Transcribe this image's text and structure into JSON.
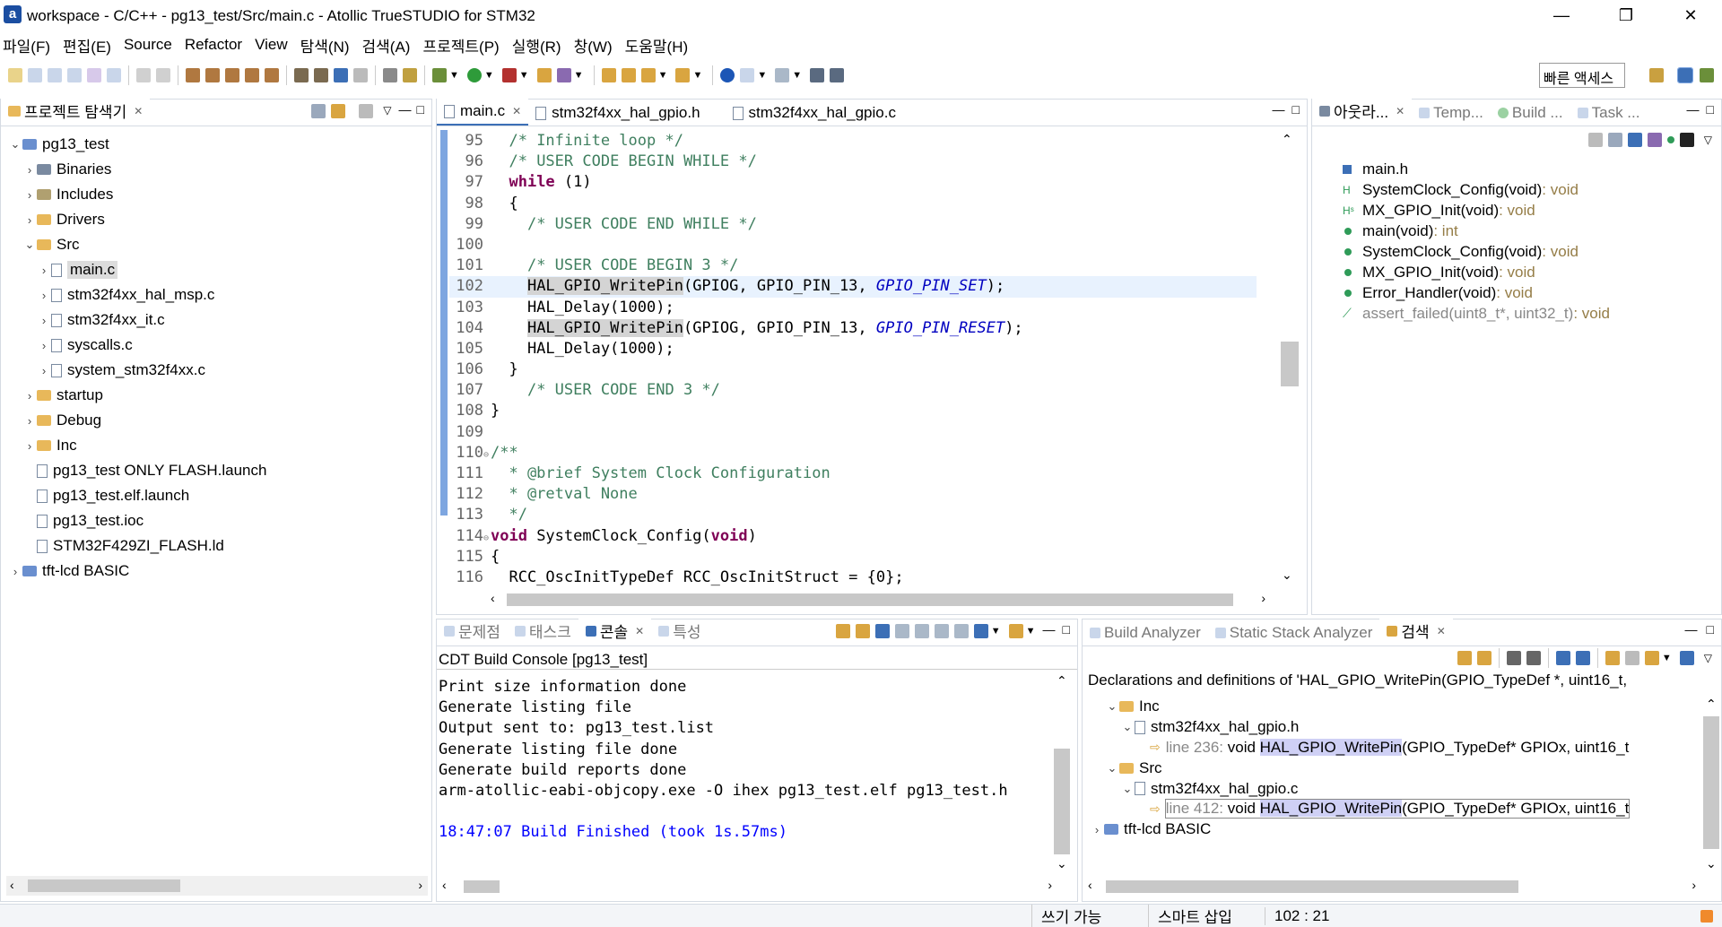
{
  "window": {
    "title": "workspace - C/C++ - pg13_test/Src/main.c - Atollic TrueSTUDIO for STM32",
    "app_icon_letter": "a",
    "minimize": "—",
    "restore": "❐",
    "close": "✕"
  },
  "menu": [
    "파일(F)",
    "편집(E)",
    "Source",
    "Refactor",
    "View",
    "탐색(N)",
    "검색(A)",
    "프로젝트(P)",
    "실행(R)",
    "창(W)",
    "도움말(H)"
  ],
  "quick_access": "빠른 액세스",
  "explorer": {
    "tab_label": "프로젝트 탐색기",
    "tree": [
      {
        "level": 0,
        "arrow": "⌄",
        "icon": "proj",
        "label": "pg13_test"
      },
      {
        "level": 1,
        "arrow": "›",
        "icon": "bin",
        "label": "Binaries"
      },
      {
        "level": 1,
        "arrow": "›",
        "icon": "inc",
        "label": "Includes"
      },
      {
        "level": 1,
        "arrow": "›",
        "icon": "fold",
        "label": "Drivers"
      },
      {
        "level": 1,
        "arrow": "⌄",
        "icon": "fold",
        "label": "Src"
      },
      {
        "level": 2,
        "arrow": "›",
        "icon": "file",
        "label": "main.c",
        "selected": true
      },
      {
        "level": 2,
        "arrow": "›",
        "icon": "file",
        "label": "stm32f4xx_hal_msp.c"
      },
      {
        "level": 2,
        "arrow": "›",
        "icon": "file",
        "label": "stm32f4xx_it.c"
      },
      {
        "level": 2,
        "arrow": "›",
        "icon": "file",
        "label": "syscalls.c"
      },
      {
        "level": 2,
        "arrow": "›",
        "icon": "file",
        "label": "system_stm32f4xx.c"
      },
      {
        "level": 1,
        "arrow": "›",
        "icon": "fold",
        "label": "startup"
      },
      {
        "level": 1,
        "arrow": "›",
        "icon": "fold",
        "label": "Debug"
      },
      {
        "level": 1,
        "arrow": "›",
        "icon": "fold",
        "label": "Inc"
      },
      {
        "level": 1,
        "arrow": "",
        "icon": "file",
        "label": "pg13_test ONLY FLASH.launch"
      },
      {
        "level": 1,
        "arrow": "",
        "icon": "file",
        "label": "pg13_test.elf.launch"
      },
      {
        "level": 1,
        "arrow": "",
        "icon": "file",
        "label": "pg13_test.ioc"
      },
      {
        "level": 1,
        "arrow": "",
        "icon": "file",
        "label": "STM32F429ZI_FLASH.ld"
      },
      {
        "level": 0,
        "arrow": "›",
        "icon": "proj",
        "label": "tft-lcd BASIC"
      }
    ]
  },
  "editor": {
    "tabs": [
      "main.c",
      "stm32f4xx_hal_gpio.h",
      "stm32f4xx_hal_gpio.c"
    ],
    "lines": [
      {
        "n": "95",
        "segs": [
          [
            "",
            "  "
          ],
          [
            "cm",
            "/* Infinite loop */"
          ]
        ]
      },
      {
        "n": "96",
        "segs": [
          [
            "",
            "  "
          ],
          [
            "cm",
            "/* USER CODE BEGIN WHILE */"
          ]
        ]
      },
      {
        "n": "97",
        "segs": [
          [
            "",
            "  "
          ],
          [
            "kw",
            "while"
          ],
          [
            "",
            " (1)"
          ]
        ]
      },
      {
        "n": "98",
        "segs": [
          [
            "",
            "  {"
          ]
        ]
      },
      {
        "n": "99",
        "segs": [
          [
            "",
            "    "
          ],
          [
            "cm",
            "/* USER CODE END WHILE */"
          ]
        ]
      },
      {
        "n": "100",
        "segs": [
          [
            "",
            ""
          ]
        ]
      },
      {
        "n": "101",
        "segs": [
          [
            "",
            "    "
          ],
          [
            "cm",
            "/* USER CODE BEGIN 3 */"
          ]
        ]
      },
      {
        "n": "102",
        "segs": [
          [
            "",
            "    "
          ],
          [
            "hl",
            "HAL_GPIO_WritePin"
          ],
          [
            "",
            "(GPIOG, GPIO_PIN_13, "
          ],
          [
            "it",
            "GPIO_PIN_SET"
          ],
          [
            "",
            ");"
          ]
        ],
        "current": true
      },
      {
        "n": "103",
        "segs": [
          [
            "",
            "    HAL_Delay(1000);"
          ]
        ]
      },
      {
        "n": "104",
        "segs": [
          [
            "",
            "    "
          ],
          [
            "hl",
            "HAL_GPIO_WritePin"
          ],
          [
            "",
            "(GPIOG, GPIO_PIN_13, "
          ],
          [
            "it",
            "GPIO_PIN_RESET"
          ],
          [
            "",
            ");"
          ]
        ]
      },
      {
        "n": "105",
        "segs": [
          [
            "",
            "    HAL_Delay(1000);"
          ]
        ]
      },
      {
        "n": "106",
        "segs": [
          [
            "",
            "  }"
          ]
        ]
      },
      {
        "n": "107",
        "segs": [
          [
            "",
            "    "
          ],
          [
            "cm",
            "/* USER CODE END 3 */"
          ]
        ]
      },
      {
        "n": "108",
        "segs": [
          [
            "",
            "}"
          ]
        ]
      },
      {
        "n": "109",
        "segs": [
          [
            "",
            ""
          ]
        ]
      },
      {
        "n": "110",
        "segs": [
          [
            "cm",
            "/**"
          ]
        ],
        "fold": "⊖"
      },
      {
        "n": "111",
        "segs": [
          [
            "cm",
            "  * @brief System Clock Configuration"
          ]
        ]
      },
      {
        "n": "112",
        "segs": [
          [
            "cm",
            "  * @retval None"
          ]
        ]
      },
      {
        "n": "113",
        "segs": [
          [
            "cm",
            "  */"
          ]
        ]
      },
      {
        "n": "114",
        "segs": [
          [
            "kw",
            "void"
          ],
          [
            "",
            " SystemClock_Config("
          ],
          [
            "kw",
            "void"
          ],
          [
            "",
            ")"
          ]
        ],
        "fold": "⊖"
      },
      {
        "n": "115",
        "segs": [
          [
            "",
            "{"
          ]
        ]
      },
      {
        "n": "116",
        "segs": [
          [
            "",
            "  RCC_OscInitTypeDef RCC_OscInitStruct = {0};"
          ]
        ]
      }
    ]
  },
  "outline": {
    "tabs": [
      "아웃라...",
      "Temp...",
      "Build ...",
      "Task ..."
    ],
    "items": [
      {
        "kind": "include",
        "name": "main.h",
        "type": ""
      },
      {
        "kind": "decl",
        "name": "SystemClock_Config(void)",
        "type": " : void"
      },
      {
        "kind": "decl-s",
        "name": "MX_GPIO_Init(void)",
        "type": " : void"
      },
      {
        "kind": "func",
        "name": "main(void)",
        "type": " : int"
      },
      {
        "kind": "func",
        "name": "SystemClock_Config(void)",
        "type": " : void"
      },
      {
        "kind": "func-s",
        "name": "MX_GPIO_Init(void)",
        "type": " : void"
      },
      {
        "kind": "func",
        "name": "Error_Handler(void)",
        "type": " : void"
      },
      {
        "kind": "inactive",
        "name": "assert_failed(uint8_t*, uint32_t)",
        "type": " : void"
      }
    ]
  },
  "console": {
    "tabs": [
      "문제점",
      "태스크",
      "콘솔",
      "특성"
    ],
    "header": "CDT Build Console [pg13_test]",
    "lines": [
      "Print size information done",
      "Generate listing file",
      "Output sent to: pg13_test.list",
      "Generate listing file done",
      "Generate build reports done",
      "arm-atollic-eabi-objcopy.exe -O ihex pg13_test.elf pg13_test.h",
      ""
    ],
    "finished": "18:47:07 Build Finished (took 1s.57ms)"
  },
  "search": {
    "tabs": [
      "Build Analyzer",
      "Static Stack Analyzer",
      "검색"
    ],
    "header": "Declarations and definitions of 'HAL_GPIO_WritePin(GPIO_TypeDef *, uint16_t,",
    "rows": [
      {
        "level": 1,
        "arrow": "⌄",
        "icon": "fold",
        "pre": "Inc",
        "hl": "",
        "post": ""
      },
      {
        "level": 2,
        "arrow": "⌄",
        "icon": "file",
        "pre": "stm32f4xx_hal_gpio.h",
        "hl": "",
        "post": ""
      },
      {
        "level": 3,
        "arrow": "",
        "icon": "match",
        "line": "line 236:",
        "pre": " void ",
        "hl": "HAL_GPIO_WritePin",
        "post": "(GPIO_TypeDef* GPIOx, uint16_t"
      },
      {
        "level": 1,
        "arrow": "⌄",
        "icon": "fold",
        "pre": "Src",
        "hl": "",
        "post": ""
      },
      {
        "level": 2,
        "arrow": "⌄",
        "icon": "file",
        "pre": "stm32f4xx_hal_gpio.c",
        "hl": "",
        "post": ""
      },
      {
        "level": 3,
        "arrow": "",
        "icon": "match",
        "line": "line 412:",
        "pre": " void ",
        "hl": "HAL_GPIO_WritePin",
        "post": "(GPIO_TypeDef* GPIOx, uint16_t",
        "selected": true
      },
      {
        "level": 0,
        "arrow": "›",
        "icon": "proj",
        "pre": "tft-lcd BASIC",
        "hl": "",
        "post": ""
      }
    ]
  },
  "status": {
    "writable": "쓰기 가능",
    "insert_mode": "스마트 삽입",
    "position": "102 : 21"
  },
  "colors": {
    "keyword": "#7f0055",
    "comment": "#3f7f5f",
    "constant": "#0000c0",
    "build_finished": "#0000ff",
    "outline_type": "#957d47"
  }
}
